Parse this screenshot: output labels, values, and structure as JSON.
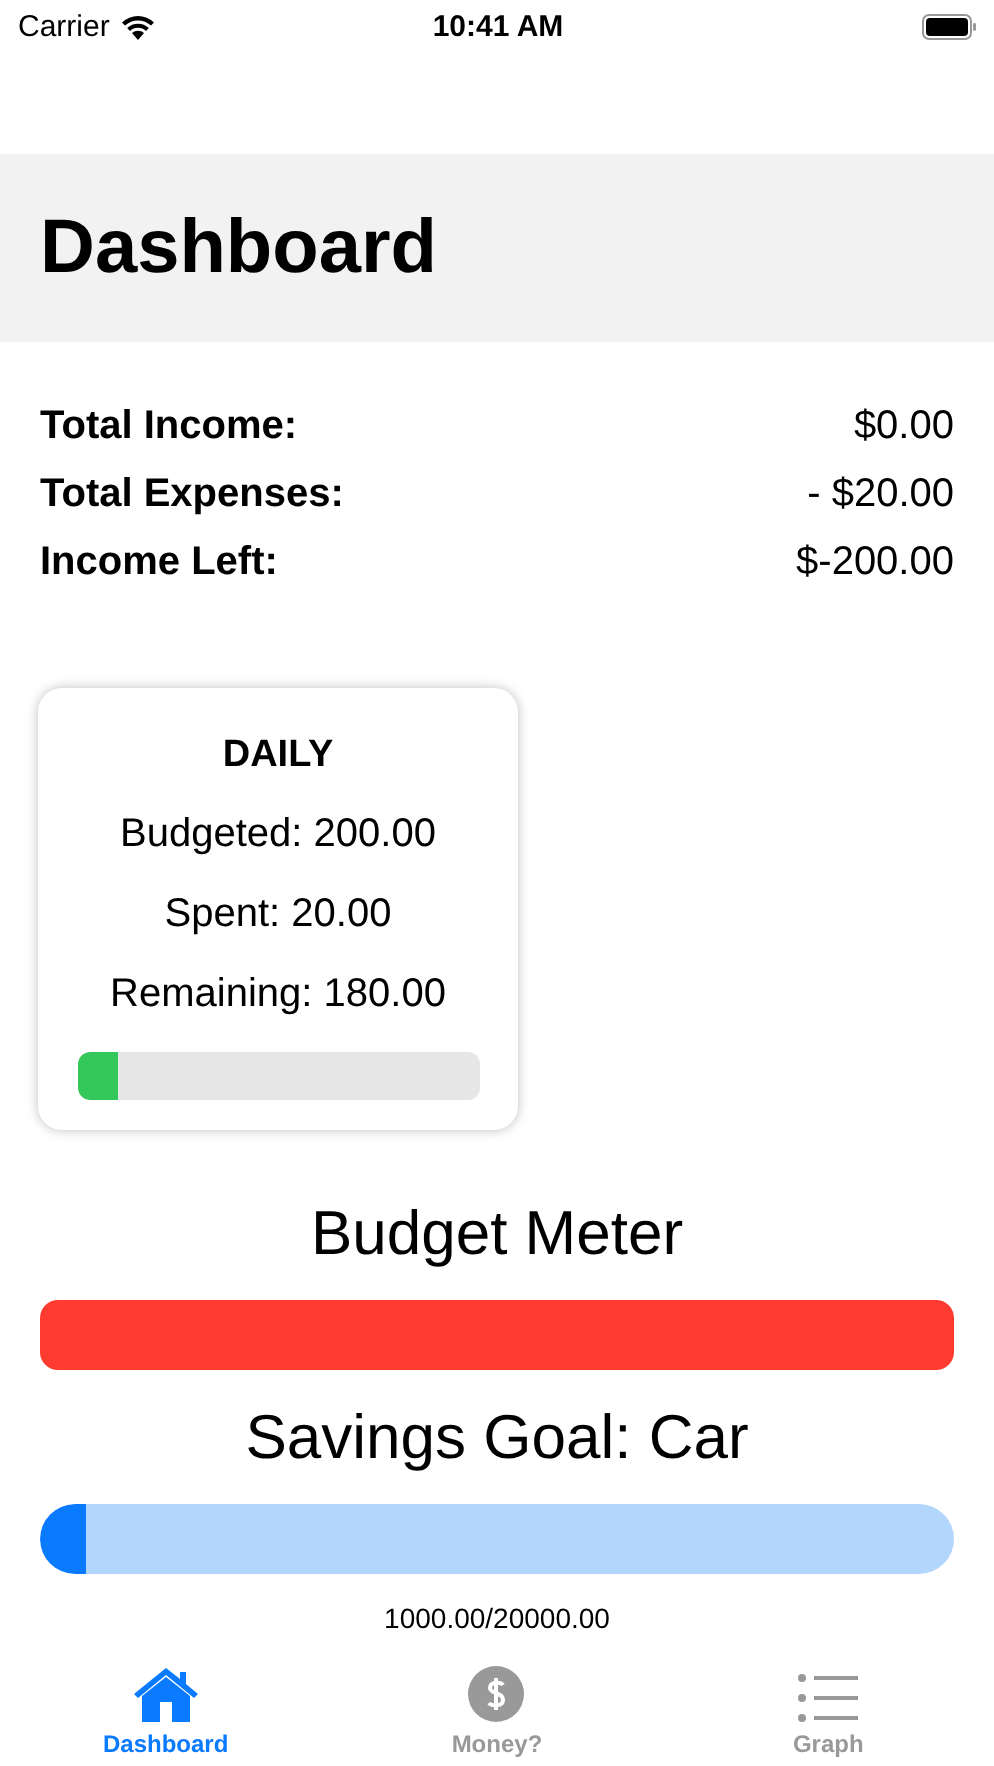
{
  "status_bar": {
    "carrier": "Carrier",
    "time": "10:41 AM"
  },
  "header": {
    "title": "Dashboard"
  },
  "summary": [
    {
      "label": "Total Income:",
      "value": "$0.00"
    },
    {
      "label": "Total Expenses:",
      "value": "- $20.00"
    },
    {
      "label": "Income Left:",
      "value": "$-200.00"
    }
  ],
  "daily_card": {
    "title": "DAILY",
    "lines": [
      "Budgeted: 200.00",
      "Spent: 20.00",
      "Remaining: 180.00"
    ],
    "level": 0.1
  },
  "budget_meter": {
    "title": "Budget Meter",
    "level": 1
  },
  "savings_goal": {
    "title": "Savings Goal: Car",
    "level": 0.05,
    "reading": "1000.00/20000.00"
  },
  "tabs": [
    {
      "label": "Dashboard",
      "kind": "home",
      "selected": true
    },
    {
      "label": "Money?",
      "kind": "dollar",
      "selected": false
    },
    {
      "label": "Graph",
      "kind": "list",
      "selected": false
    }
  ]
}
